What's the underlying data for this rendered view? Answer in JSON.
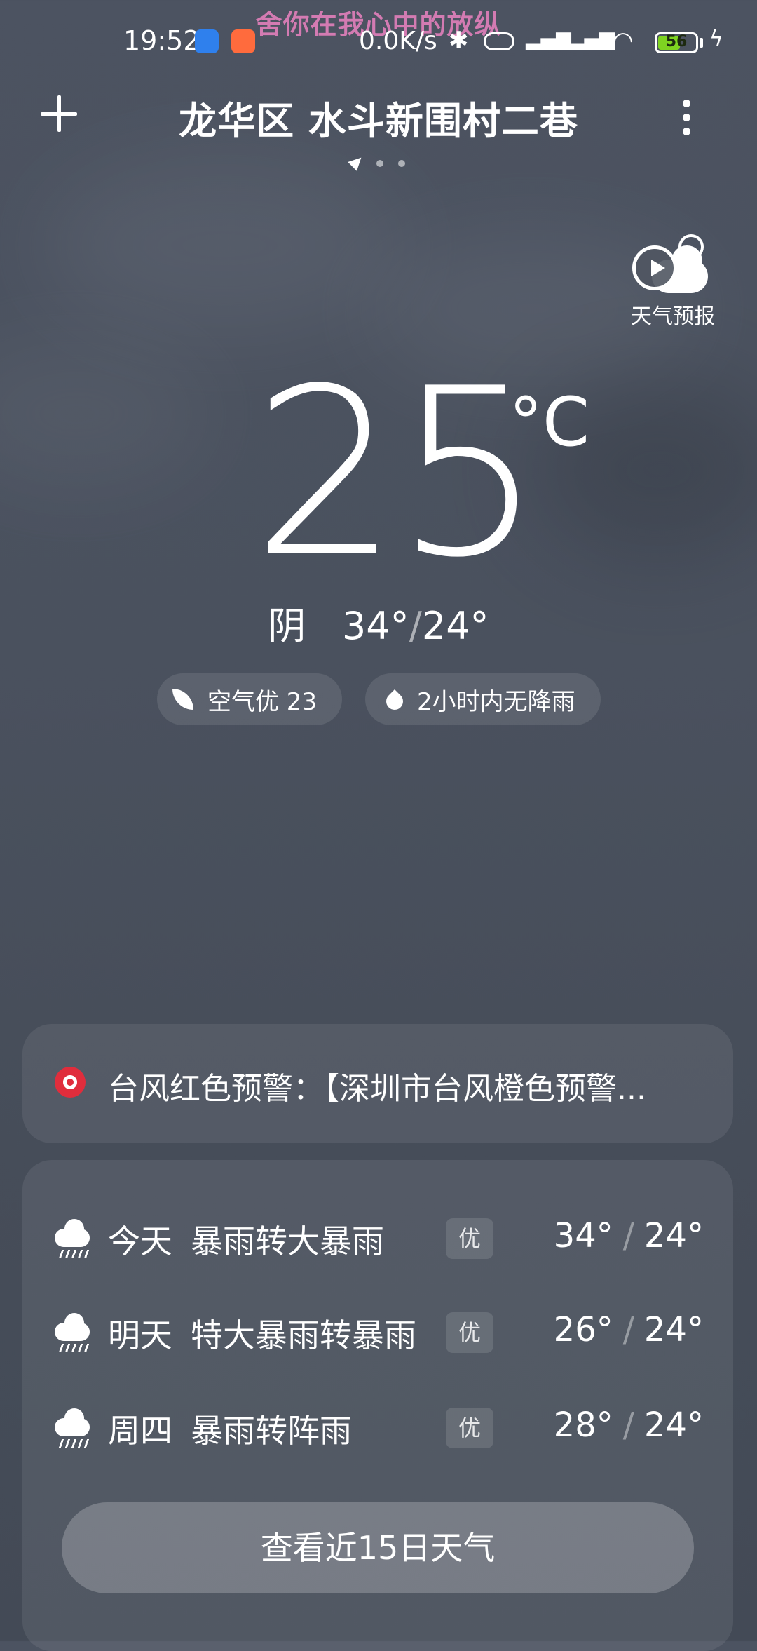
{
  "status_bar": {
    "time": "19:52",
    "lyric": "舍你在我心中的放纵",
    "net_speed": "0.0K/s",
    "battery": "56",
    "battery_level": 0.56
  },
  "header": {
    "location": "龙华区 水斗新围村二巷",
    "page_count": 3,
    "current_page": 1
  },
  "forecast_video": {
    "label": "天气预报"
  },
  "current": {
    "temp": "25",
    "unit": "°C",
    "condition": "阴",
    "high": "34°",
    "slash": "/",
    "low": "24°"
  },
  "chips": {
    "aqi": "空气优 23",
    "rain": "2小时内无降雨"
  },
  "alert": {
    "text": "台风红色预警：【深圳市台风橙色预警...",
    "color": "#e02d3c"
  },
  "forecast": [
    {
      "day": "今天",
      "condition": "暴雨转大暴雨",
      "aqi": "优",
      "high": "34°",
      "low": "24°"
    },
    {
      "day": "明天",
      "condition": "特大暴雨转暴雨",
      "aqi": "优",
      "high": "26°",
      "low": "24°"
    },
    {
      "day": "周四",
      "condition": "暴雨转阵雨",
      "aqi": "优",
      "high": "28°",
      "low": "24°"
    }
  ],
  "temp_separator": "/",
  "more_days_label": "查看近15日天气"
}
